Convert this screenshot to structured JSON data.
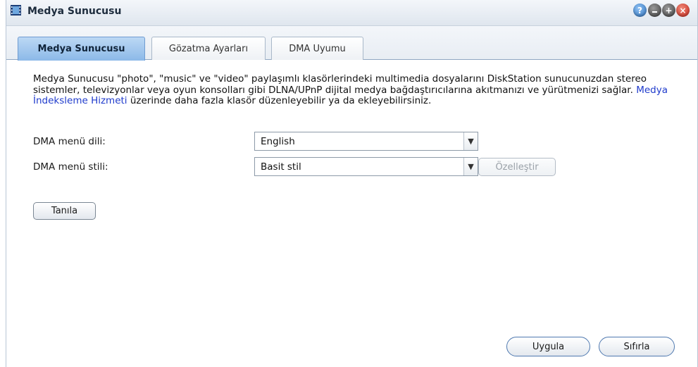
{
  "window": {
    "title": "Medya Sunucusu",
    "icon": "film-strip-icon",
    "controls": [
      "help-icon",
      "minimize-icon",
      "maximize-icon",
      "close-icon"
    ]
  },
  "tabs": [
    {
      "label": "Medya Sunucusu",
      "active": true
    },
    {
      "label": "Gözatma Ayarları",
      "active": false
    },
    {
      "label": "DMA Uyumu",
      "active": false
    }
  ],
  "description": {
    "before_link": "Medya Sunucusu \"photo\", \"music\" ve \"video\" paylaşımlı klasörlerindeki multimedia dosyalarını DiskStation sunucunuzdan stereo sistemler, televizyonlar veya oyun konsolları gibi DLNA/UPnP dijital medya bağdaştırıcılarına akıtmanızı ve yürütmenizi sağlar. ",
    "link": "Medya İndeksleme Hizmeti",
    "after_link": " üzerinde daha fazla klasör düzenleyebilir ya da ekleyebilirsiniz."
  },
  "form": {
    "language": {
      "label": "DMA menü dili:",
      "value": "English"
    },
    "style": {
      "label": "DMA menü stili:",
      "value": "Basit stil"
    },
    "customize_label": "Özelleştir",
    "diagnose_label": "Tanıla"
  },
  "footer": {
    "apply_label": "Uygula",
    "reset_label": "Sıfırla"
  },
  "colors": {
    "link": "#1f3bcc",
    "active_tab": "#8cb9e8",
    "close_button": "#c3261a"
  }
}
